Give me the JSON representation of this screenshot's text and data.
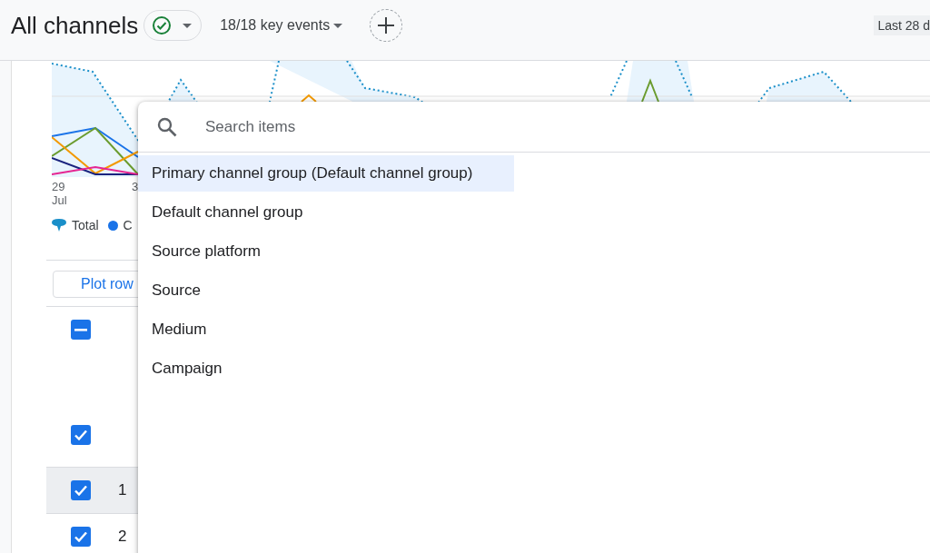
{
  "header": {
    "title": "All channels",
    "status": {
      "checked": true
    },
    "key_events": "18/18 key events",
    "date_range": "Last 28 d"
  },
  "chart": {
    "axis_labels": [
      {
        "day": "29",
        "month": "Jul"
      },
      {
        "day": "3"
      }
    ],
    "legend": [
      {
        "label": "Total",
        "kind": "total",
        "color": "#1a8fc9"
      },
      {
        "label": "C",
        "kind": "dot",
        "color": "#1a73e8"
      }
    ]
  },
  "plot_button": "Plot row",
  "table": {
    "header_checkbox": {
      "kind": "indeterminate"
    },
    "total_checkbox": {
      "checked": true
    },
    "rows": [
      {
        "index": "1",
        "checked": true,
        "selected": true
      },
      {
        "index": "2",
        "checked": true,
        "selected": false
      }
    ]
  },
  "menu": {
    "search": {
      "placeholder": "Search items"
    },
    "items": [
      {
        "label": "Primary channel group (Default channel group)",
        "selected": true
      },
      {
        "label": "Default channel group",
        "selected": false
      },
      {
        "label": "Source platform",
        "selected": false
      },
      {
        "label": "Source",
        "selected": false
      },
      {
        "label": "Medium",
        "selected": false
      },
      {
        "label": "Campaign",
        "selected": false
      }
    ]
  }
}
